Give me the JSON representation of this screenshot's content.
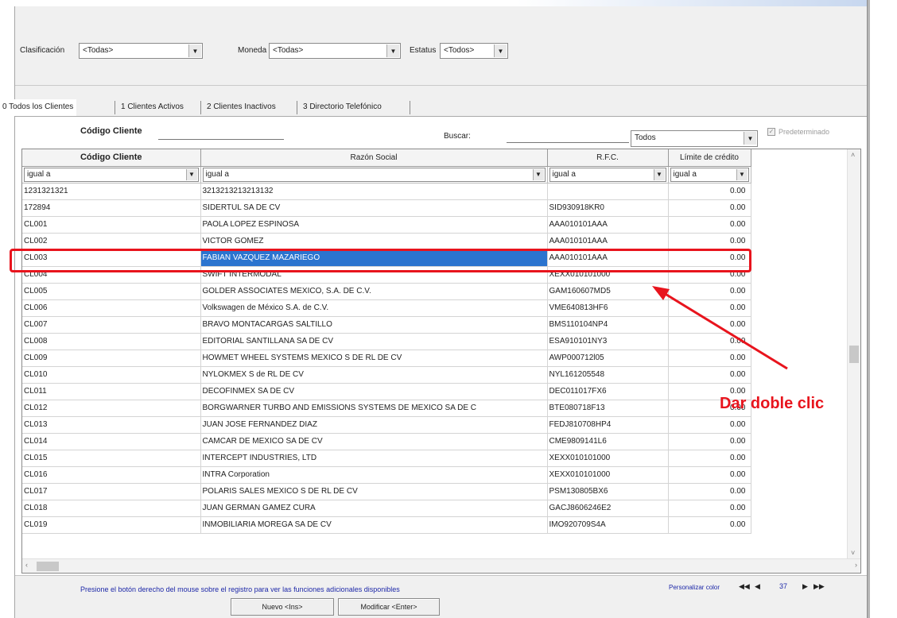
{
  "filters": {
    "clasificacion_label": "Clasificación",
    "clasificacion_value": "<Todas>",
    "moneda_label": "Moneda",
    "moneda_value": "<Todas>",
    "estatus_label": "Estatus",
    "estatus_value": "<Todos>"
  },
  "tabs": [
    {
      "label": "0 Todos los Clientes"
    },
    {
      "label": "1 Clientes Activos"
    },
    {
      "label": "2 Clientes Inactivos"
    },
    {
      "label": "3 Directorio Telefónico"
    }
  ],
  "search": {
    "codigo_label": "Código Cliente",
    "buscar_label": "Buscar:",
    "buscar_scope": "Todos",
    "predeterminado_label": "Predeterminado"
  },
  "grid": {
    "columns": [
      "Código Cliente",
      "Razón Social",
      "R.F.C.",
      "Límite de crédito"
    ],
    "filter_ops": [
      "igual a",
      "igual a",
      "igual a",
      "igual a"
    ],
    "rows": [
      {
        "codigo": "1231321321",
        "razon": "3213213213213132",
        "rfc": "",
        "limite": "0.00"
      },
      {
        "codigo": "172894",
        "razon": "SIDERTUL SA DE CV",
        "rfc": "SID930918KR0",
        "limite": "0.00"
      },
      {
        "codigo": "CL001",
        "razon": "PAOLA LOPEZ ESPINOSA",
        "rfc": "AAA010101AAA",
        "limite": "0.00"
      },
      {
        "codigo": "CL002",
        "razon": "VICTOR GOMEZ",
        "rfc": "AAA010101AAA",
        "limite": "0.00"
      },
      {
        "codigo": "CL003",
        "razon": "FABIAN VAZQUEZ MAZARIEGO",
        "rfc": "AAA010101AAA",
        "limite": "0.00"
      },
      {
        "codigo": "CL004",
        "razon": "SWIFT INTERMODAL",
        "rfc": "XEXX010101000",
        "limite": "0.00"
      },
      {
        "codigo": "CL005",
        "razon": "GOLDER ASSOCIATES MEXICO, S.A. DE C.V.",
        "rfc": "GAM160607MD5",
        "limite": "0.00"
      },
      {
        "codigo": "CL006",
        "razon": "Volkswagen de México S.A. de C.V.",
        "rfc": "VME640813HF6",
        "limite": "0.00"
      },
      {
        "codigo": "CL007",
        "razon": "BRAVO MONTACARGAS SALTILLO",
        "rfc": "BMS110104NP4",
        "limite": "0.00"
      },
      {
        "codigo": "CL008",
        "razon": "EDITORIAL SANTILLANA SA DE CV",
        "rfc": "ESA910101NY3",
        "limite": "0.00"
      },
      {
        "codigo": "CL009",
        "razon": "HOWMET WHEEL SYSTEMS MEXICO S DE RL DE CV",
        "rfc": "AWP000712l05",
        "limite": "0.00"
      },
      {
        "codigo": "CL010",
        "razon": "NYLOKMEX S de RL DE CV",
        "rfc": "NYL161205548",
        "limite": "0.00"
      },
      {
        "codigo": "CL011",
        "razon": "DECOFINMEX SA DE CV",
        "rfc": "DEC011017FX6",
        "limite": "0.00"
      },
      {
        "codigo": "CL012",
        "razon": "BORGWARNER TURBO AND EMISSIONS SYSTEMS DE MEXICO SA DE C",
        "rfc": "BTE080718F13",
        "limite": "0.00"
      },
      {
        "codigo": "CL013",
        "razon": "JUAN JOSE FERNANDEZ DIAZ",
        "rfc": "FEDJ810708HP4",
        "limite": "0.00"
      },
      {
        "codigo": "CL014",
        "razon": "CAMCAR DE MEXICO SA DE CV",
        "rfc": "CME9809141L6",
        "limite": "0.00"
      },
      {
        "codigo": "CL015",
        "razon": "INTERCEPT INDUSTRIES, LTD",
        "rfc": "XEXX010101000",
        "limite": "0.00"
      },
      {
        "codigo": "CL016",
        "razon": "INTRA Corporation",
        "rfc": "XEXX010101000",
        "limite": "0.00"
      },
      {
        "codigo": "CL017",
        "razon": "POLARIS SALES MEXICO S DE RL DE CV",
        "rfc": "PSM130805BX6",
        "limite": "0.00"
      },
      {
        "codigo": "CL018",
        "razon": "JUAN GERMAN GAMEZ CURA",
        "rfc": "GACJ8606246E2",
        "limite": "0.00"
      },
      {
        "codigo": "CL019",
        "razon": "INMOBILIARIA MOREGA SA DE CV",
        "rfc": "IMO920709S4A",
        "limite": "0.00"
      }
    ]
  },
  "status": {
    "hint": "Presione el botón derecho del mouse sobre el registro para ver las funciones adicionales disponibles",
    "personalizar": "Personalizar color",
    "record_number": "37",
    "nuevo_label": "Nuevo <Ins>",
    "modificar_label": "Modificar <Enter>"
  },
  "annotation": {
    "text": "Dar doble  clic",
    "color": "#e8141d"
  },
  "colors": {
    "selection": "#2b74cf",
    "hint_text": "#1d28a8"
  }
}
